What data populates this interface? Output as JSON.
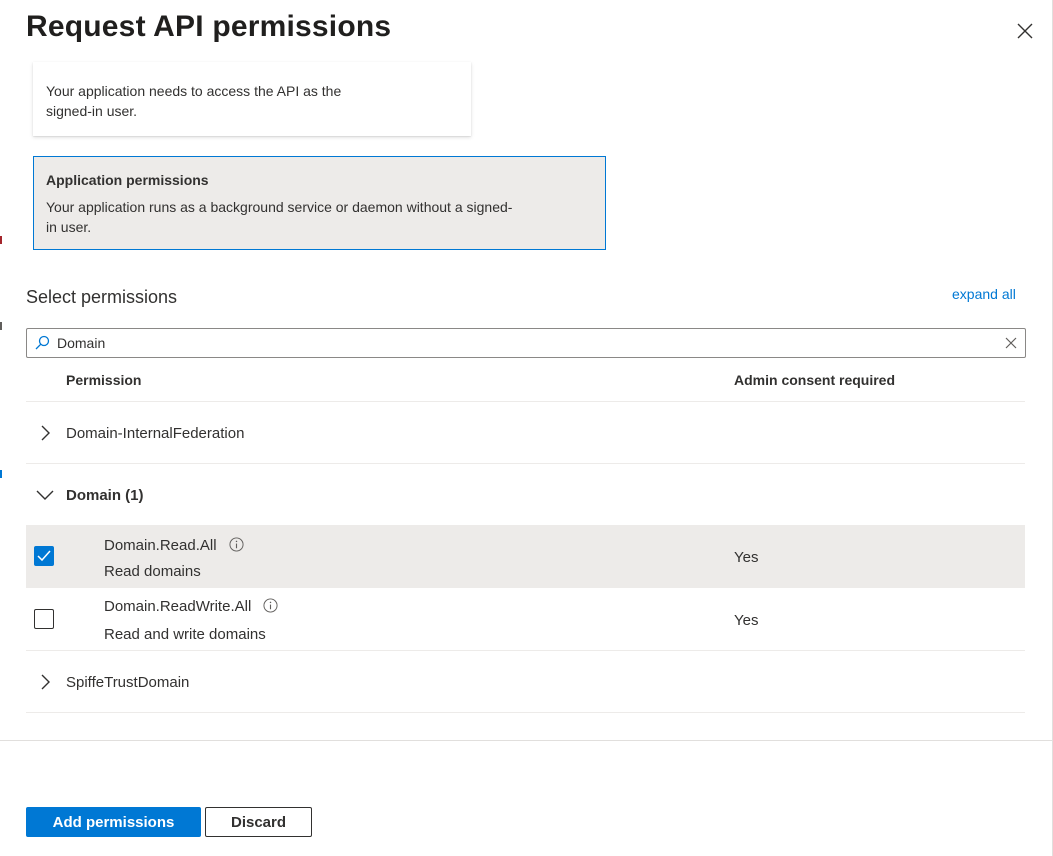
{
  "panel": {
    "title": "Request API permissions",
    "close_icon": "close-icon"
  },
  "permission_types": {
    "delegated": {
      "description": "Your application needs to access the API as the signed-in user."
    },
    "application": {
      "title": "Application permissions",
      "description": "Your application runs as a background service or daemon without a signed-in user.",
      "selected": true
    }
  },
  "select_permissions": {
    "label": "Select permissions",
    "expand_all": "expand all",
    "search": {
      "value": "Domain",
      "icon": "search-icon"
    }
  },
  "table": {
    "columns": {
      "permission": "Permission",
      "admin_consent": "Admin consent required"
    },
    "groups": [
      {
        "label": "Domain-InternalFederation",
        "expanded": false
      },
      {
        "label": "Domain (1)",
        "expanded": true,
        "permissions": [
          {
            "name": "Domain.Read.All",
            "description": "Read domains",
            "admin_consent": "Yes",
            "checked": true
          },
          {
            "name": "Domain.ReadWrite.All",
            "description": "Read and write domains",
            "admin_consent": "Yes",
            "checked": false
          }
        ]
      },
      {
        "label": "SpiffeTrustDomain",
        "expanded": false
      }
    ]
  },
  "footer": {
    "add_label": "Add permissions",
    "discard_label": "Discard"
  },
  "colors": {
    "accent": "#0078d4",
    "selected_bg": "#edebe9",
    "text": "#323130"
  }
}
